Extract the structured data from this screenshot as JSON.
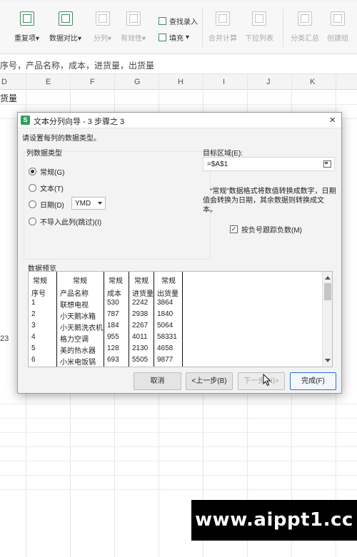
{
  "ribbon": {
    "items": [
      {
        "label": "重复项",
        "has_dropdown": true,
        "disabled": false
      },
      {
        "label": "数据对比",
        "has_dropdown": true,
        "disabled": false
      },
      {
        "label": "分列",
        "has_dropdown": true,
        "disabled": true
      },
      {
        "label": "有效性",
        "has_dropdown": true,
        "disabled": true
      },
      {
        "label": "查找录入",
        "disabled": false
      },
      {
        "label": "填充",
        "has_dropdown": true,
        "disabled": false
      },
      {
        "label": "合并计算",
        "disabled": true
      },
      {
        "label": "下拉列表",
        "disabled": true
      },
      {
        "label": "分类汇总",
        "disabled": true
      },
      {
        "label": "创建组",
        "disabled": true
      }
    ],
    "dropdown_glyph": "▾"
  },
  "formula_bar": {
    "content": "序号，产品名称，成本，进货量，出货量"
  },
  "sheet": {
    "columns": [
      "D",
      "E",
      "F",
      "G",
      "H",
      "I",
      "J",
      "K"
    ],
    "cells": [
      {
        "text": "货量"
      },
      {
        "text": "23"
      }
    ]
  },
  "dialog": {
    "title": "文本分列向导 - 3 步骤之 3",
    "app_icon": "S",
    "close_glyph": "×",
    "instruction": "请设置每列的数据类型。",
    "column_type_group": "列数据类型",
    "radios": [
      {
        "label": "常规(G)",
        "checked": true
      },
      {
        "label": "文本(T)",
        "checked": false
      },
      {
        "label": "日期(D)",
        "checked": false
      },
      {
        "label": "不导入此列(跳过)(I)",
        "checked": false
      }
    ],
    "date_format": "YMD",
    "target_label": "目标区域(E):",
    "target_value": "=$A$1",
    "note": "“常规”数据格式将数值转换成数字，日期值会转换为日期，其余数据则转换成文本。",
    "checkbox_label": "按负号跟踪负数(M)",
    "checkbox_checked": true,
    "preview_label": "数据预览",
    "preview": {
      "headers": [
        "常规",
        "常规",
        "常规",
        "常规",
        "常规"
      ],
      "rows": [
        [
          "序号",
          "产品名称",
          "成本",
          "进货量",
          "出货量"
        ],
        [
          "1",
          "联想电视",
          "530",
          "2242",
          "3864"
        ],
        [
          "2",
          "小天鹅冰箱",
          "787",
          "2938",
          "1840"
        ],
        [
          "3",
          "小天鹅洗衣机",
          "184",
          "2267",
          "5064"
        ],
        [
          "4",
          "格力空调",
          "955",
          "4011",
          "58331"
        ],
        [
          "5",
          "美的热水器",
          "128",
          "2130",
          "4658"
        ],
        [
          "6",
          "小米电饭锅",
          "693",
          "5505",
          "9877"
        ]
      ]
    },
    "buttons": {
      "cancel": "取消",
      "back": "<上一步(B)",
      "next": "下一步(N)>",
      "finish": "完成(F)"
    }
  },
  "watermark": "www.aippt1.cc"
}
